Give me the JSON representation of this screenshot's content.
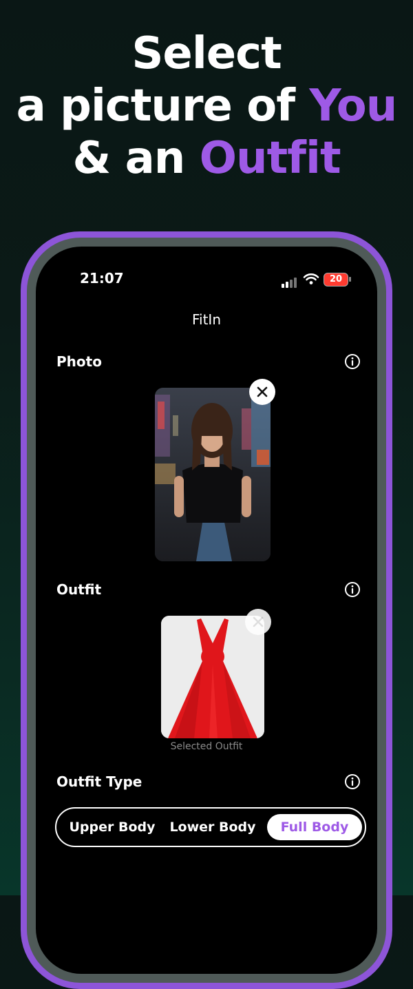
{
  "headline": {
    "line1": "Select",
    "line2_prefix": "a picture of ",
    "line2_accent": "You",
    "line3_prefix": "& an ",
    "line3_accent": "Outfit"
  },
  "status_bar": {
    "time": "21:07",
    "battery_level": "20"
  },
  "app": {
    "title": "FitIn"
  },
  "sections": {
    "photo": {
      "label": "Photo"
    },
    "outfit": {
      "label": "Outfit",
      "caption": "Selected Outfit"
    },
    "outfit_type": {
      "label": "Outfit Type",
      "options": [
        "Upper Body",
        "Lower Body",
        "Full Body"
      ],
      "selected": "Full Body"
    }
  },
  "icons": {
    "info": "info-icon",
    "close": "close-icon",
    "signal": "cellular-signal-icon",
    "wifi": "wifi-icon",
    "battery": "battery-icon"
  },
  "colors": {
    "accent": "#9e5ae6",
    "frame": "#8d55d8",
    "battery_low": "#ff3b30",
    "dress": "#e0161b"
  }
}
